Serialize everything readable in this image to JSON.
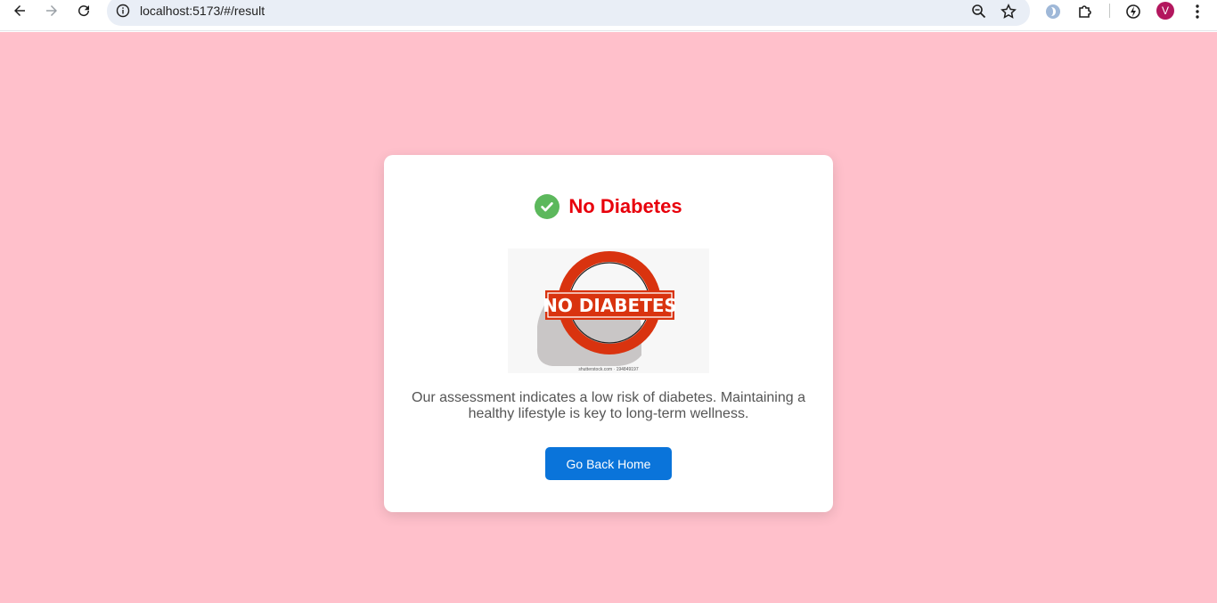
{
  "browser": {
    "url": "localhost:5173/#/result",
    "profile_initial": "V",
    "icons": [
      "back-arrow-icon",
      "forward-arrow-icon",
      "reload-icon",
      "site-info-icon",
      "zoom-icon",
      "bookmark-star-icon",
      "extension-app-icon",
      "extensions-puzzle-icon",
      "performance-icon",
      "menu-kebab-icon"
    ]
  },
  "result": {
    "title": "No Diabetes",
    "image_text": "NO DIABETES",
    "image_caption": "shutterstock.com · 194849197",
    "message": "Our assessment indicates a low risk of diabetes. Maintaining a healthy lifestyle is key to long-term wellness.",
    "button_label": "Go Back Home"
  },
  "colors": {
    "page_background": "#ffc0cb",
    "title": "#e8000b",
    "check": "#5cb85c",
    "button": "#0a74da",
    "sign_red": "#d9330f"
  }
}
